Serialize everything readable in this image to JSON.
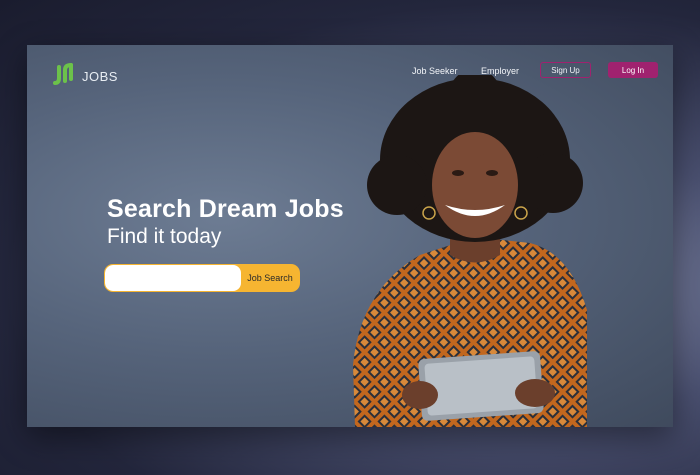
{
  "brand": {
    "name": "JOBS",
    "logo_icon": "jobs-logo-icon",
    "logo_color": "#6cc24a"
  },
  "nav": {
    "job_seeker": "Job Seeker",
    "employer": "Employer",
    "sign_up": "Sign Up",
    "log_in": "Log In"
  },
  "hero": {
    "title": "Search Dream Jobs",
    "subtitle": "Find it today",
    "search_value": "",
    "search_button": "Job Search"
  },
  "colors": {
    "accent": "#a0226f",
    "search_button": "#f6b531"
  }
}
